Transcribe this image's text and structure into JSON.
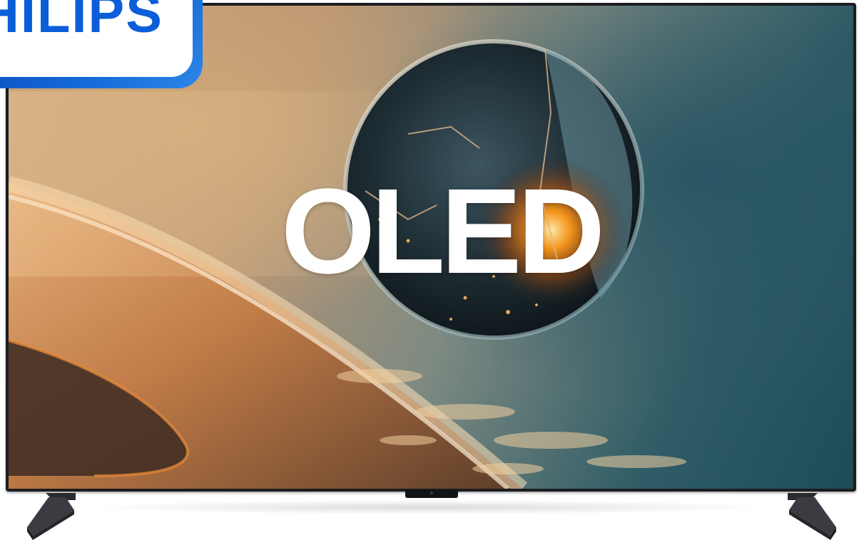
{
  "brand": {
    "text": "HILIPS",
    "color": "#0b5ed7",
    "badge_gradient": [
      "#0a49b8",
      "#2d86e8"
    ]
  },
  "screen": {
    "headline": "OLED",
    "headline_color": "#ffffff"
  },
  "colors": {
    "frame": "#1c1d20",
    "background": "#ffffff",
    "sky_warm": "#c9a178",
    "sky_teal": "#1d4c57",
    "glow_orange": "#ff9a1a"
  },
  "icons": {
    "stand_left": "tv-stand-foot-icon",
    "stand_right": "tv-stand-foot-icon",
    "sensor": "ir-sensor-icon"
  }
}
